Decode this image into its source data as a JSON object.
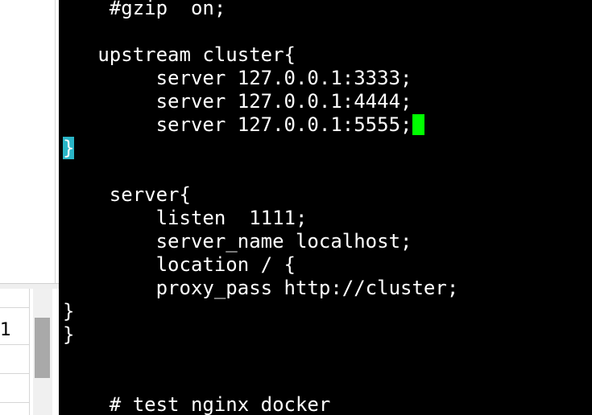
{
  "side_window": {
    "cell_value": "1"
  },
  "terminal": {
    "lines": [
      "    #gzip  on;",
      "",
      "   upstream cluster{",
      "        server 127.0.0.1:3333;",
      "        server 127.0.0.1:4444;",
      "        server 127.0.0.1:5555;",
      "}",
      "",
      "",
      "    server{",
      "        listen  1111;",
      "        server_name localhost;",
      "        location / {",
      "        proxy_pass http://cluster;",
      "}",
      "}",
      "",
      "",
      "    # test nginx docker"
    ],
    "cursor_color": "#00ff00",
    "bracket_highlight_color": "#2ab5c7"
  }
}
